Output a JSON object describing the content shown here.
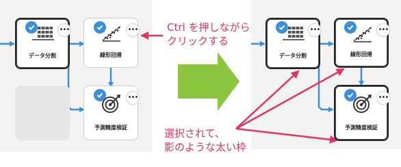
{
  "nodes": {
    "split": {
      "label": "データ分割",
      "icon": "data-table-icon"
    },
    "regression": {
      "label": "線形回帰",
      "icon": "scatter-regression-icon"
    },
    "evaluate": {
      "label": "予測精度検証",
      "icon": "target-arrow-icon"
    }
  },
  "annotations": {
    "top": [
      "Ctrl を押しながら",
      "クリックする"
    ],
    "bottom": [
      "選択されて、",
      "影のような太い枠"
    ]
  },
  "colors": {
    "accent": "#3b8fd6",
    "annotation": "#e0345e",
    "big_arrow": "#8cc63f",
    "selected_border": "#222222"
  }
}
